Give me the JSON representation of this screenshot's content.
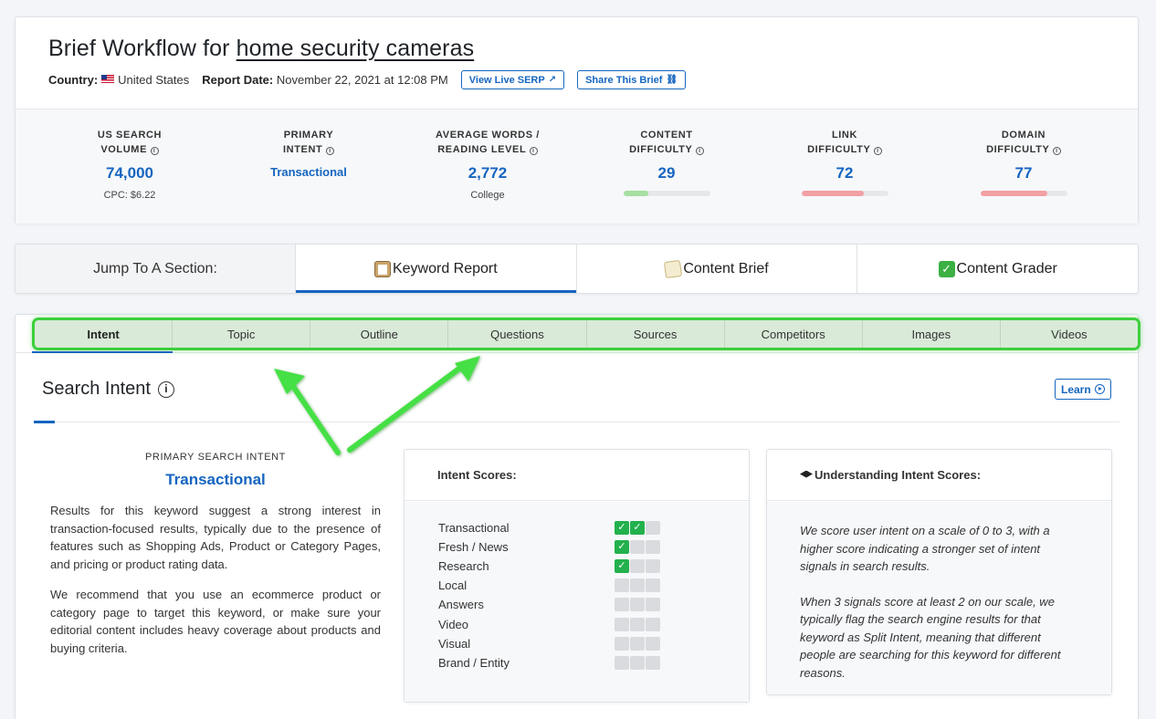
{
  "header": {
    "title_prefix": "Brief Workflow for ",
    "keyword": "home security cameras",
    "country_label": "Country:",
    "country": "United States",
    "report_date_label": "Report Date:",
    "report_date": "November 22, 2021 at 12:08 PM",
    "view_serp_label": "View Live SERP",
    "share_label": "Share This Brief"
  },
  "stats": [
    {
      "line1": "US SEARCH",
      "line2": "VOLUME",
      "value": "74,000",
      "sub": "CPC: $6.22"
    },
    {
      "line1": "PRIMARY",
      "line2": "INTENT",
      "value": "Transactional",
      "sub": ""
    },
    {
      "line1": "AVERAGE WORDS /",
      "line2": "READING LEVEL",
      "value": "2,772",
      "sub": "College"
    },
    {
      "line1": "CONTENT",
      "line2": "DIFFICULTY",
      "value": "29",
      "bar_pct": 29,
      "bar_color": "#a6dfa0"
    },
    {
      "line1": "LINK",
      "line2": "DIFFICULTY",
      "value": "72",
      "bar_pct": 72,
      "bar_color": "#f2a0a4"
    },
    {
      "line1": "DOMAIN",
      "line2": "DIFFICULTY",
      "value": "77",
      "bar_pct": 77,
      "bar_color": "#f2a0a4"
    }
  ],
  "jump": {
    "label": "Jump To A Section:",
    "tabs": [
      "Keyword Report",
      "Content Brief",
      "Content Grader"
    ]
  },
  "subtabs": [
    "Intent",
    "Topic",
    "Outline",
    "Questions",
    "Sources",
    "Competitors",
    "Images",
    "Videos"
  ],
  "section": {
    "title": "Search Intent",
    "learn_label": "Learn",
    "primary_label": "PRIMARY SEARCH INTENT",
    "primary_value": "Transactional",
    "para1": "Results for this keyword suggest a strong interest in transaction-focused results, typically due to the presence of features such as Shopping Ads, Product or Category Pages, and pricing or product rating data.",
    "para2": "We recommend that you use an ecommerce product or category page to target this keyword, or make sure your editorial content includes heavy coverage about products and buying criteria."
  },
  "intent_scores": {
    "title": "Intent Scores:",
    "rows": [
      {
        "name": "Transactional",
        "score": 2
      },
      {
        "name": "Fresh / News",
        "score": 1
      },
      {
        "name": "Research",
        "score": 1
      },
      {
        "name": "Local",
        "score": 0
      },
      {
        "name": "Answers",
        "score": 0
      },
      {
        "name": "Video",
        "score": 0
      },
      {
        "name": "Visual",
        "score": 0
      },
      {
        "name": "Brand / Entity",
        "score": 0
      }
    ]
  },
  "understanding": {
    "title": "Understanding Intent Scores:",
    "p1": "We score user intent on a scale of 0 to 3, with a higher score indicating a stronger set of intent signals in search results.",
    "p2": "When 3 signals score at least 2 on our scale, we typically flag the search engine results for that keyword as Split Intent, meaning that different people are searching for this keyword for different reasons."
  },
  "colors": {
    "accent": "#1565c0",
    "highlight": "#3ccf3c"
  }
}
